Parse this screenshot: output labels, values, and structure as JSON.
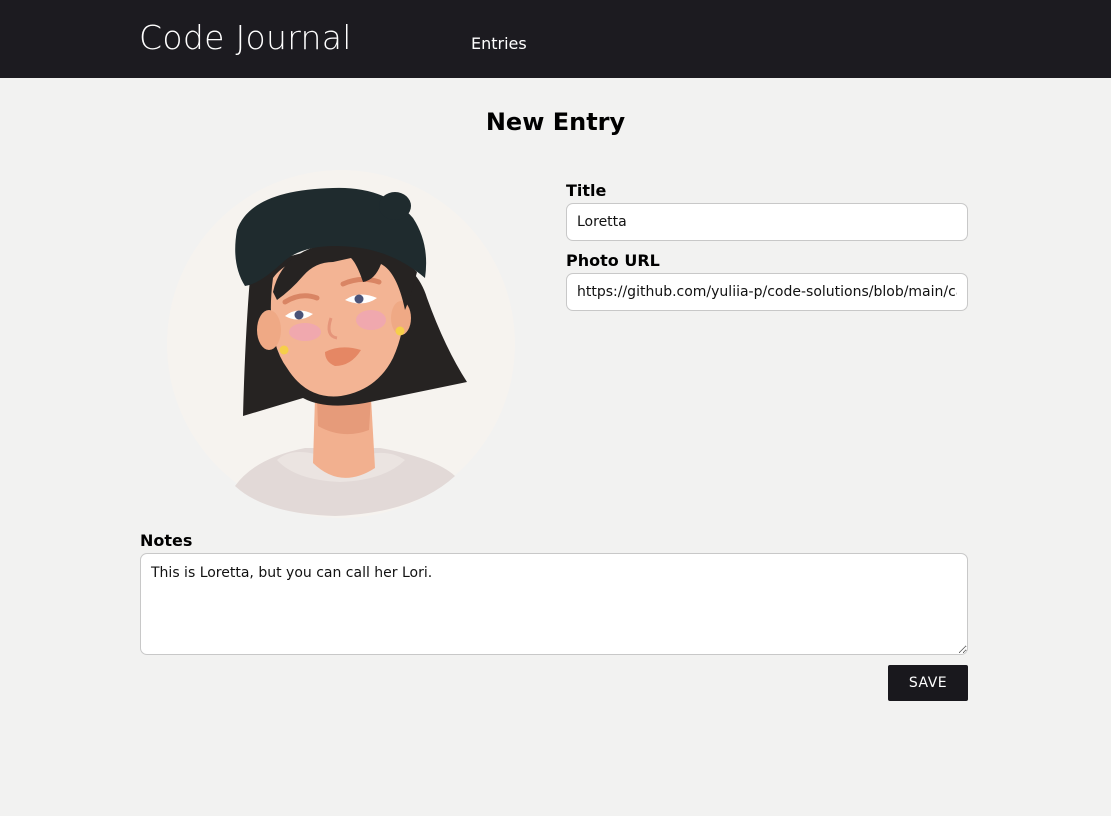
{
  "navbar": {
    "brand": "Code Journal",
    "link_entries": "Entries"
  },
  "form": {
    "heading": "New Entry",
    "title": {
      "label": "Title",
      "value": "Loretta"
    },
    "photo_url": {
      "label": "Photo URL",
      "value": "https://github.com/yuliia-p/code-solutions/blob/main/card"
    },
    "notes": {
      "label": "Notes",
      "value": "This is Loretta, but you can call her Lori."
    },
    "save_label": "SAVE"
  },
  "colors": {
    "navbar_bg": "#1c1b20",
    "page_bg": "#f2f2f1",
    "button_bg": "#19181d"
  }
}
